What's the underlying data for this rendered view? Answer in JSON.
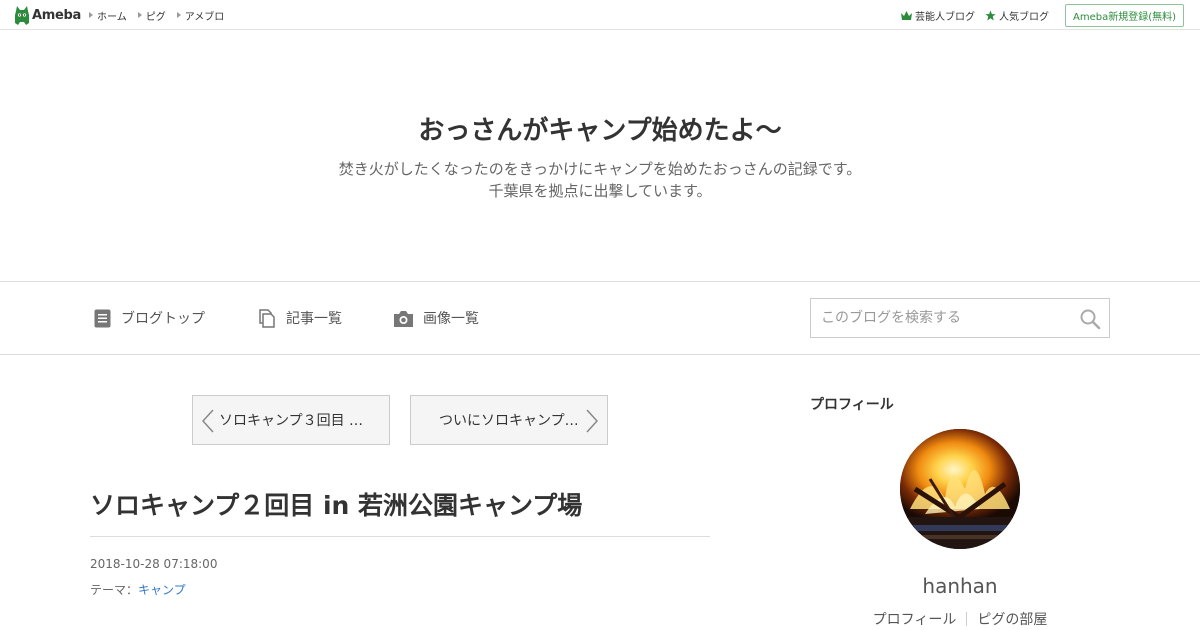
{
  "global_header": {
    "logo_text": "Ameba",
    "nav": [
      "ホーム",
      "ピグ",
      "アメブロ"
    ],
    "right_links": [
      {
        "label": "芸能人ブログ",
        "icon": "crown-icon"
      },
      {
        "label": "人気ブログ",
        "icon": "star-icon"
      }
    ],
    "register_label": "Ameba新規登録(無料)"
  },
  "blog": {
    "title": "おっさんがキャンプ始めたよ〜",
    "description_line1": "焚き火がしたくなったのをきっかけにキャンプを始めたおっさんの記録です。",
    "description_line2": "千葉県を拠点に出撃しています。"
  },
  "blog_nav": {
    "items": [
      {
        "label": "ブログトップ",
        "icon": "document-icon"
      },
      {
        "label": "記事一覧",
        "icon": "copy-icon"
      },
      {
        "label": "画像一覧",
        "icon": "camera-icon"
      }
    ],
    "search_placeholder": "このブログを検索する"
  },
  "article": {
    "prev_label": "ソロキャンプ３回目 …",
    "next_label": "ついにソロキャンプ…",
    "title": "ソロキャンプ２回目 in 若洲公園キャンプ場",
    "date": "2018-10-28 07:18:00",
    "theme_prefix": "テーマ：",
    "theme": "キャンプ"
  },
  "sidebar": {
    "heading": "プロフィール",
    "profile_name": "hanhan",
    "links": [
      "プロフィール",
      "ピグの部屋"
    ]
  },
  "colors": {
    "accent_green": "#2d8c3c",
    "link_blue": "#3478c6"
  }
}
